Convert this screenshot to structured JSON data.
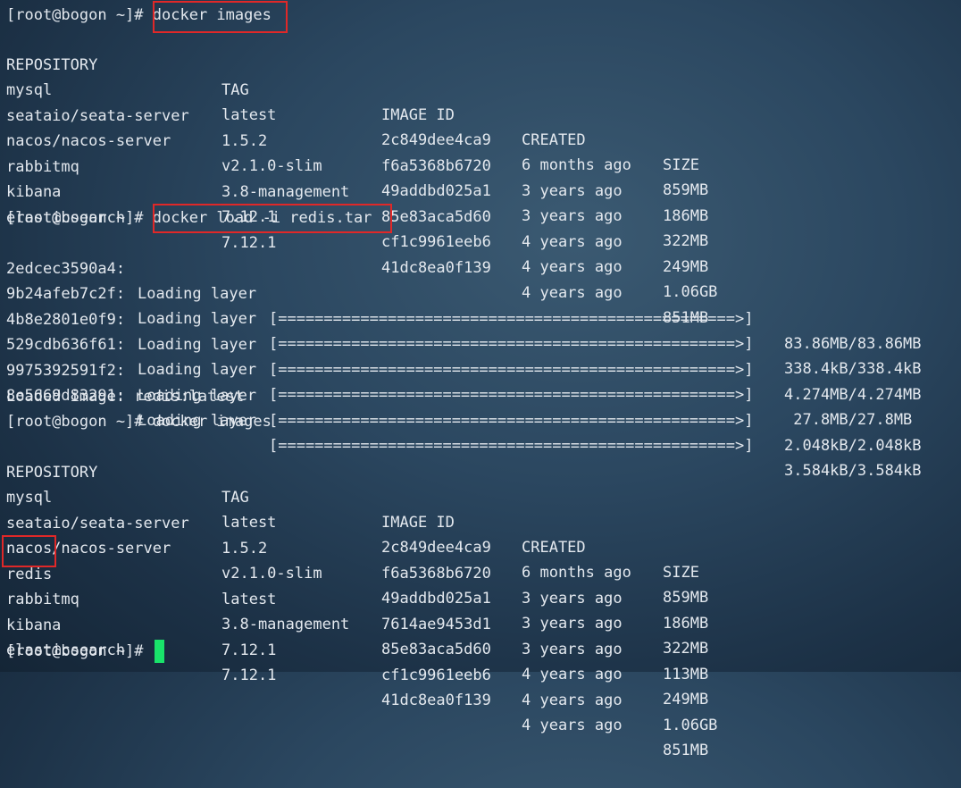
{
  "prompt": "[root@bogon ~]#",
  "block1": {
    "command": "docker images",
    "headers": [
      "REPOSITORY",
      "TAG",
      "IMAGE ID",
      "CREATED",
      "SIZE"
    ],
    "rows": [
      [
        "mysql",
        "latest",
        "2c849dee4ca9",
        "6 months ago",
        "859MB"
      ],
      [
        "seataio/seata-server",
        "1.5.2",
        "f6a5368b6720",
        "3 years ago",
        "186MB"
      ],
      [
        "nacos/nacos-server",
        "v2.1.0-slim",
        "49addbd025a1",
        "3 years ago",
        "322MB"
      ],
      [
        "rabbitmq",
        "3.8-management",
        "85e83aca5d60",
        "4 years ago",
        "249MB"
      ],
      [
        "kibana",
        "7.12.1",
        "cf1c9961eeb6",
        "4 years ago",
        "1.06GB"
      ],
      [
        "elasticsearch",
        "7.12.1",
        "41dc8ea0f139",
        "4 years ago",
        "851MB"
      ]
    ]
  },
  "block2": {
    "command": "docker load -i redis.tar",
    "layers": [
      {
        "id": "2edcec3590a4:",
        "action": "Loading layer",
        "bar": "[==================================================>]",
        "progress": "83.86MB/83.86MB"
      },
      {
        "id": "9b24afeb7c2f:",
        "action": "Loading layer",
        "bar": "[==================================================>]",
        "progress": "338.4kB/338.4kB"
      },
      {
        "id": "4b8e2801e0f9:",
        "action": "Loading layer",
        "bar": "[==================================================>]",
        "progress": "4.274MB/4.274MB"
      },
      {
        "id": "529cdb636f61:",
        "action": "Loading layer",
        "bar": "[==================================================>]",
        "progress": " 27.8MB/27.8MB"
      },
      {
        "id": "9975392591f2:",
        "action": "Loading layer",
        "bar": "[==================================================>]",
        "progress": "2.048kB/2.048kB"
      },
      {
        "id": "8e5669d83291:",
        "action": "Loading layer",
        "bar": "[==================================================>]",
        "progress": "3.584kB/3.584kB"
      }
    ],
    "result": "Loaded image: redis:latest"
  },
  "block3": {
    "command": "docker images",
    "headers": [
      "REPOSITORY",
      "TAG",
      "IMAGE ID",
      "CREATED",
      "SIZE"
    ],
    "rows": [
      [
        "mysql",
        "latest",
        "2c849dee4ca9",
        "6 months ago",
        "859MB"
      ],
      [
        "seataio/seata-server",
        "1.5.2",
        "f6a5368b6720",
        "3 years ago",
        "186MB"
      ],
      [
        "nacos/nacos-server",
        "v2.1.0-slim",
        "49addbd025a1",
        "3 years ago",
        "322MB"
      ],
      [
        "redis",
        "latest",
        "7614ae9453d1",
        "3 years ago",
        "113MB"
      ],
      [
        "rabbitmq",
        "3.8-management",
        "85e83aca5d60",
        "4 years ago",
        "249MB"
      ],
      [
        "kibana",
        "7.12.1",
        "cf1c9961eeb6",
        "4 years ago",
        "1.06GB"
      ],
      [
        "elasticsearch",
        "7.12.1",
        "41dc8ea0f139",
        "4 years ago",
        "851MB"
      ]
    ]
  },
  "theme": {
    "background": "#2b4760",
    "text": "#e3e8ee",
    "highlight_box": "#e02828",
    "cursor": "#19e36a"
  }
}
